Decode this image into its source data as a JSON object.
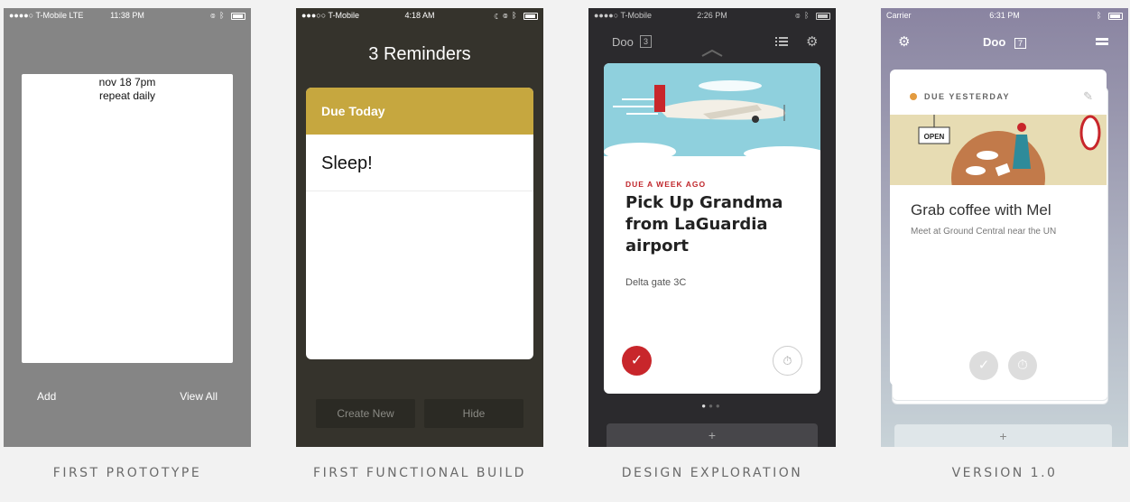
{
  "phones": [
    {
      "status": {
        "left": "●●●●○ T-Mobile  LTE",
        "time": "11:38 PM"
      },
      "sheet_lines": [
        "nov 18 7pm",
        "repeat daily"
      ],
      "buttons": {
        "add": "Add",
        "view_all": "View All"
      },
      "caption": "FIRST PROTOTYPE"
    },
    {
      "status": {
        "left": "●●●○○ T-Mobile",
        "time": "4:18 AM"
      },
      "title": "3 Reminders",
      "card": {
        "header": "Due Today",
        "item": "Sleep!"
      },
      "buttons": {
        "create_new": "Create New",
        "hide": "Hide"
      },
      "caption": "FIRST FUNCTIONAL BUILD"
    },
    {
      "status": {
        "left": "●●●●○ T-Mobile",
        "time": "2:26 PM"
      },
      "app_title": "Doo",
      "count": "3",
      "card": {
        "due": "DUE A WEEK AGO",
        "task": "Pick Up Grandma from LaGuardia airport",
        "note": "Delta gate 3C"
      },
      "add_label": "+",
      "caption": "DESIGN EXPLORATION"
    },
    {
      "status": {
        "left": "Carrier",
        "time": "6:31 PM"
      },
      "app_title": "Doo",
      "count": "7",
      "card": {
        "due": "DUE YESTERDAY",
        "sign": "OPEN",
        "task": "Grab coffee with Mel",
        "note": "Meet at Ground Central near the UN"
      },
      "add_label": "+",
      "caption": "VERSION 1.0"
    }
  ],
  "colors": {
    "due_today": "#c6a73f",
    "due_red": "#c8262b",
    "due_orange": "#e39b40"
  },
  "icons": [
    "wifi-icon",
    "bluetooth-icon",
    "battery-icon",
    "list-icon",
    "gear-icon",
    "check-icon",
    "timer-icon",
    "edit-icon",
    "plus-icon",
    "airplane-illustration",
    "coffee-illustration"
  ]
}
